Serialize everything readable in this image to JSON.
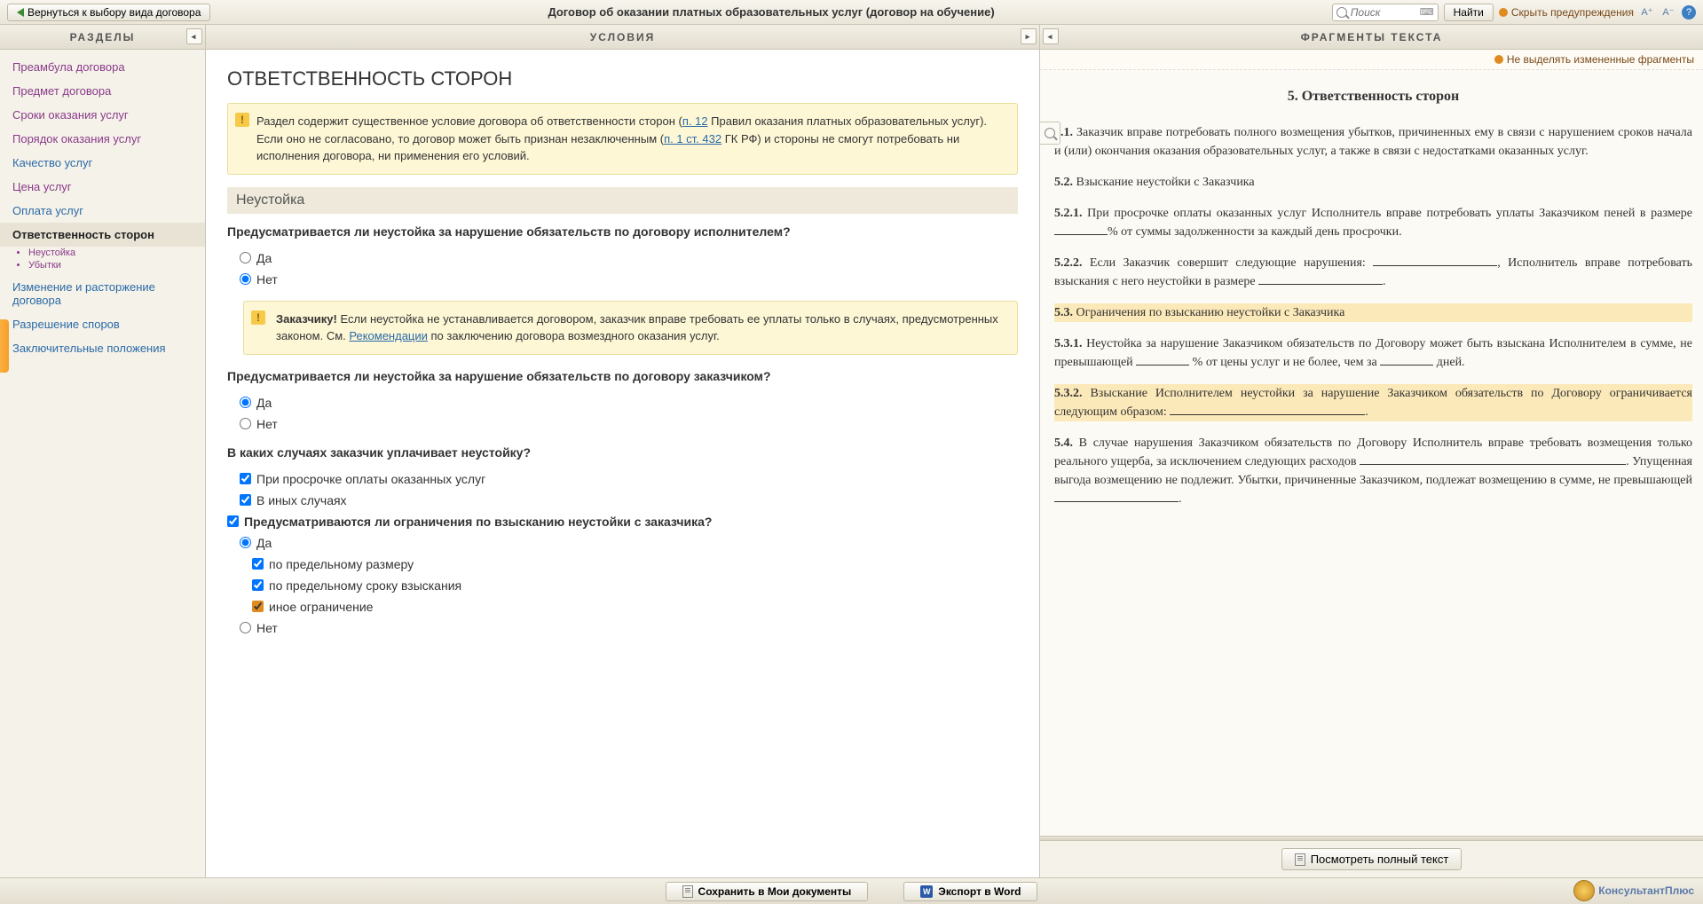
{
  "toolbar": {
    "back_label": "Вернуться к выбору вида договора",
    "title": "Договор об оказании платных образовательных услуг (договор на обучение)",
    "search_placeholder": "Поиск",
    "find_label": "Найти",
    "hide_warnings_label": "Скрыть предупреждения"
  },
  "sidebar": {
    "header": "РАЗДЕЛЫ",
    "items": [
      {
        "label": "Преамбула договора",
        "style": "purple"
      },
      {
        "label": "Предмет договора",
        "style": "purple"
      },
      {
        "label": "Сроки оказания услуг",
        "style": "purple"
      },
      {
        "label": "Порядок оказания услуг",
        "style": "purple"
      },
      {
        "label": "Качество услуг",
        "style": "blue"
      },
      {
        "label": "Цена услуг",
        "style": "purple"
      },
      {
        "label": "Оплата услуг",
        "style": "blue"
      },
      {
        "label": "Ответственность сторон",
        "style": "active",
        "subs": [
          "Неустойка",
          "Убытки"
        ]
      },
      {
        "label": "Изменение и расторжение договора",
        "style": "blue"
      },
      {
        "label": "Разрешение споров",
        "style": "blue"
      },
      {
        "label": "Заключительные положения",
        "style": "blue"
      }
    ]
  },
  "conditions": {
    "header": "УСЛОВИЯ",
    "title": "ОТВЕТСТВЕННОСТЬ СТОРОН",
    "warning1_pre": "Раздел содержит существенное условие договора об ответственности сторон (",
    "warning1_link1": "п. 12",
    "warning1_mid1": " Правил оказания платных образовательных услуг). Если оно не согласовано, то договор может быть признан незаключенным (",
    "warning1_link2": "п. 1 ст. 432",
    "warning1_mid2": " ГК РФ) и стороны не смогут потребовать ни исполнения договора, ни применения его условий.",
    "subhead_penalty": "Неустойка",
    "q1": "Предусматривается ли неустойка за нарушение обязательств по договору исполнителем?",
    "opt_yes": "Да",
    "opt_no": "Нет",
    "warning2_strong": "Заказчику!",
    "warning2_body": " Если неустойка не устанавливается договором, заказчик вправе требовать ее уплаты только в случаях, предусмотренных законом. См. ",
    "warning2_link": "Рекомендации",
    "warning2_tail": " по заключению договора возмездного оказания услуг.",
    "q2": "Предусматривается ли неустойка за нарушение обязательств по договору заказчиком?",
    "q3": "В каких случаях заказчик уплачивает неустойку?",
    "q3_opt1": "При просрочке оплаты оказанных услуг",
    "q3_opt2": "В иных случаях",
    "q4": "Предусматриваются ли ограничения по взысканию неустойки с заказчика?",
    "q4_opt1": "по предельному размеру",
    "q4_opt2": "по предельному сроку взыскания",
    "q4_opt3": "иное ограничение"
  },
  "fragments": {
    "header": "ФРАГМЕНТЫ ТЕКСТА",
    "no_highlight": "Не выделять измененные фрагменты",
    "doc_title": "5. Ответственность сторон",
    "p51_num": "5.1.",
    "p51": " Заказчик вправе потребовать полного возмещения убытков, причиненных ему в связи с нарушением сроков начала и (или) окончания оказания образовательных услуг, а также в связи с недостатками оказанных услуг.",
    "p52_num": "5.2.",
    "p52": " Взыскание неустойки с Заказчика",
    "p521_num": "5.2.1.",
    "p521_a": " При просрочке оплаты оказанных услуг Исполнитель вправе потребовать уплаты Заказчиком пеней в размере ",
    "p521_b": "% от суммы задолженности за каждый день просрочки.",
    "p522_num": "5.2.2.",
    "p522_a": " Если Заказчик совершит следующие нарушения: ",
    "p522_b": ", Исполнитель вправе потребовать взыскания с него неустойки в размере ",
    "p522_c": ".",
    "p53_num": "5.3.",
    "p53": " Ограничения по взысканию неустойки с Заказчика",
    "p531_num": "5.3.1.",
    "p531_a": " Неустойка за нарушение Заказчиком обязательств по Договору может быть взыскана Исполнителем в сумме, не превышающей ",
    "p531_b": " % от цены услуг и не более, чем за ",
    "p531_c": " дней.",
    "p532_num": "5.3.2.",
    "p532_a": " Взыскание Исполнителем неустойки за нарушение Заказчиком обязательств по Договору ограничивается следующим образом: ",
    "p532_b": ".",
    "p54_num": "5.4.",
    "p54_a": " В случае нарушения Заказчиком обязательств по Договору Исполнитель вправе требовать возмещения только реального ущерба, за исключением следующих расходов ",
    "p54_b": ". Упущенная выгода возмещению не подлежит. Убытки, причиненные Заказчиком, подлежат возмещению в сумме, не превышающей ",
    "p54_c": ".",
    "view_full": "Посмотреть полный текст"
  },
  "footer": {
    "save_label": "Сохранить в Мои документы",
    "export_label": "Экспорт в Word",
    "logo": "КонсультантПлюс"
  }
}
